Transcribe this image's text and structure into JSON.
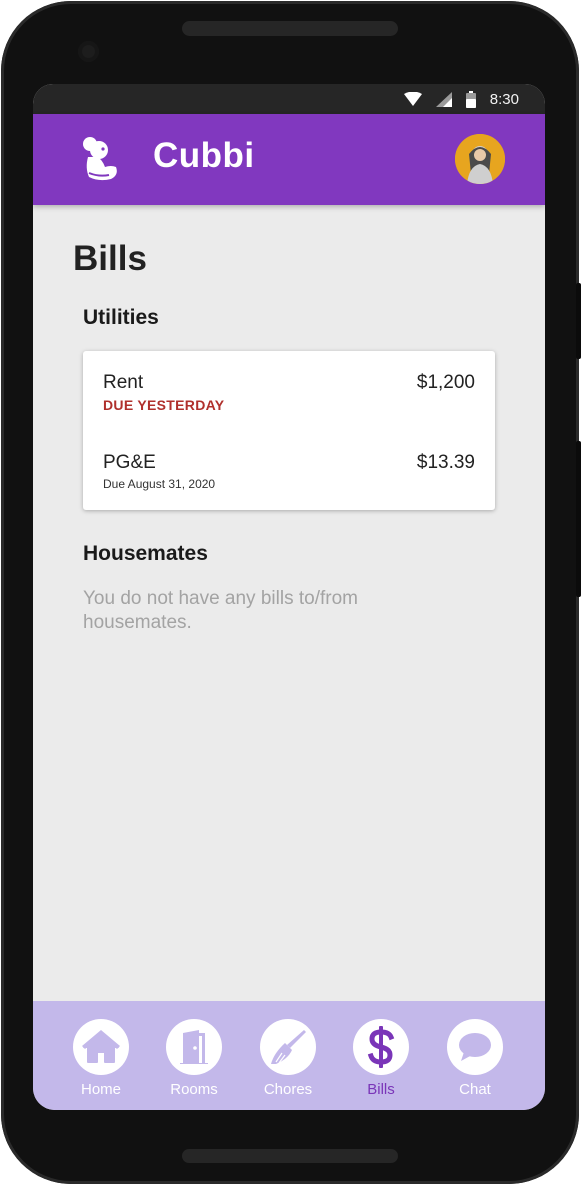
{
  "status_bar": {
    "time": "8:30"
  },
  "app_bar": {
    "title": "Cubbi"
  },
  "page": {
    "title": "Bills"
  },
  "utilities": {
    "heading": "Utilities",
    "bills": [
      {
        "name": "Rent",
        "amount": "$1,200",
        "due": "DUE YESTERDAY",
        "overdue": true
      },
      {
        "name": "PG&E",
        "amount": "$13.39",
        "due": "Due August 31, 2020",
        "overdue": false
      }
    ]
  },
  "housemates": {
    "heading": "Housemates",
    "empty_message": "You do not have any bills to/from housemates."
  },
  "nav": {
    "items": [
      {
        "label": "Home",
        "icon": "home-icon"
      },
      {
        "label": "Rooms",
        "icon": "door-icon"
      },
      {
        "label": "Chores",
        "icon": "broom-icon"
      },
      {
        "label": "Bills",
        "icon": "dollar-icon",
        "active": true
      },
      {
        "label": "Chat",
        "icon": "chat-bubble-icon"
      }
    ]
  },
  "colors": {
    "brand": "#8138bf",
    "nav_background": "#c3b8ea",
    "overdue": "#b0302c",
    "screen_background": "#ebebeb"
  }
}
